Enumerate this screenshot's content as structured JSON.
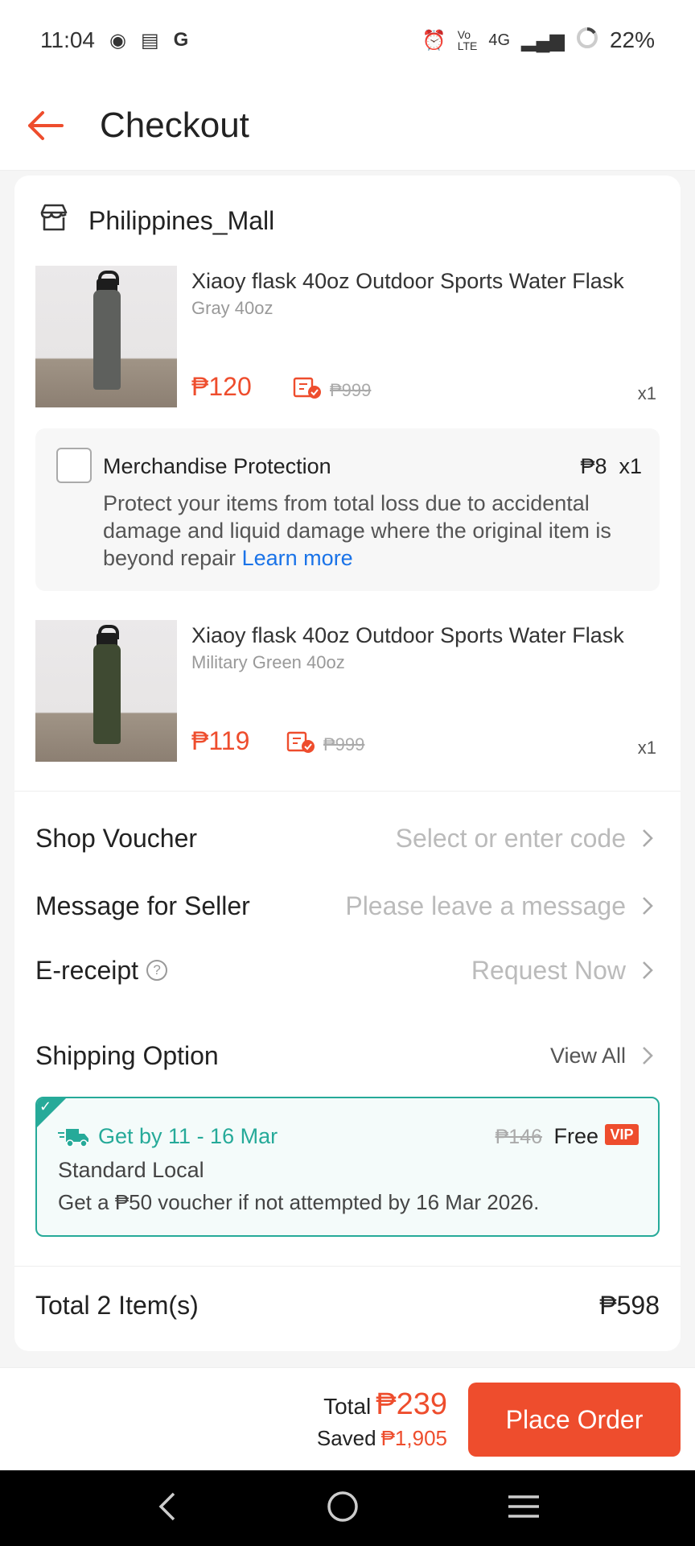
{
  "status_bar": {
    "time": "11:04",
    "network": "4G",
    "battery": "22%"
  },
  "header": {
    "title": "Checkout"
  },
  "shop": {
    "name": "Philippines_Mall"
  },
  "products": [
    {
      "title": "Xiaoy flask 40oz Outdoor Sports Water Flask",
      "variant": "Gray 40oz",
      "price": "₱120",
      "original_price": "₱999",
      "quantity": "x1",
      "bottle_color": "#5e605d"
    },
    {
      "title": "Xiaoy flask 40oz Outdoor Sports Water Flask",
      "variant": "Military Green 40oz",
      "price": "₱119",
      "original_price": "₱999",
      "quantity": "x1",
      "bottle_color": "#3f4a32"
    }
  ],
  "protection": {
    "title": "Merchandise Protection",
    "price": "₱8  x1",
    "description": "Protect your items from total loss due to accidental damage and liquid damage where the original item is beyond repair ",
    "learn_more": "Learn more",
    "checked": false
  },
  "options": {
    "shop_voucher_label": "Shop Voucher",
    "shop_voucher_value": "Select or enter code",
    "message_label": "Message for Seller",
    "message_placeholder": "Please leave a message",
    "ereceipt_label": "E-receipt",
    "ereceipt_value": "Request Now",
    "shipping_label": "Shipping Option",
    "shipping_view_all": "View All"
  },
  "shipping": {
    "date": "Get by 11 - 16 Mar",
    "original_fee": "₱146",
    "fee": "Free",
    "badge": "VIP",
    "method": "Standard Local",
    "note": "Get a ₱50 voucher if not attempted by 16 Mar 2026."
  },
  "order_total": {
    "label": "Total 2 Item(s)",
    "amount": "₱598"
  },
  "summary": {
    "total_label": "Total",
    "total_amount": "₱239",
    "saved_label": "Saved",
    "saved_amount": "₱1,905",
    "button": "Place Order"
  },
  "colors": {
    "accent": "#ee4d2d",
    "shipping_green": "#26aa99",
    "link_blue": "#1a73e8"
  }
}
